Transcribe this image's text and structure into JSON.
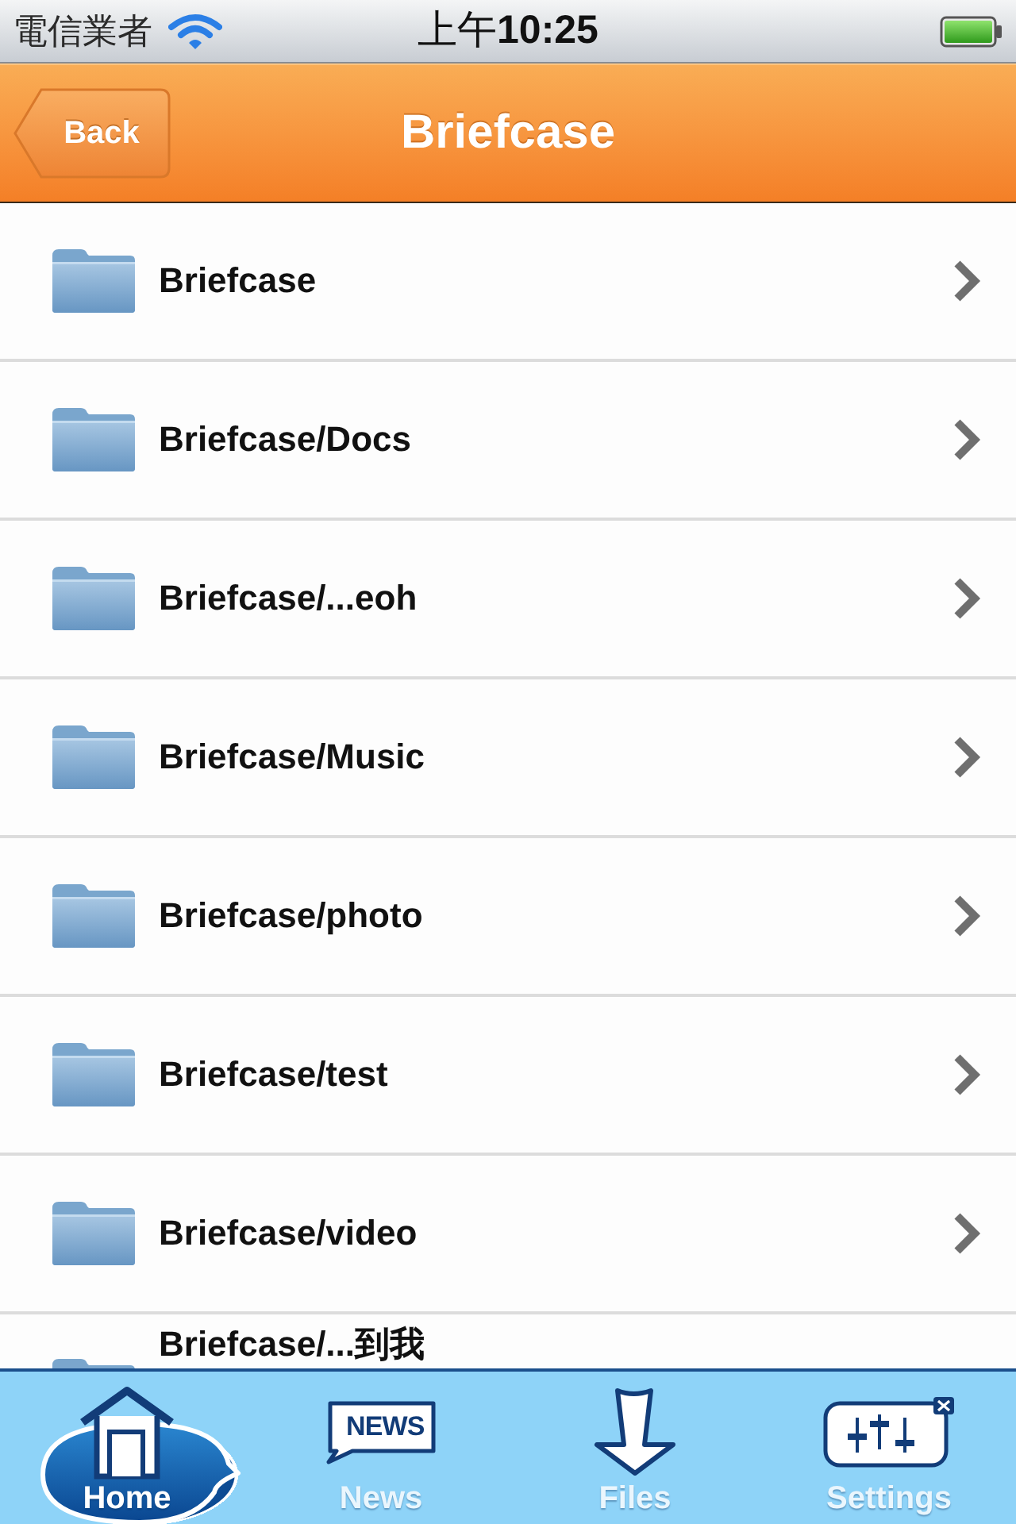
{
  "status_bar": {
    "carrier": "電信業者",
    "time": "上午**10:25**"
  },
  "nav_bar": {
    "back_button": "Back",
    "title": "Briefcase"
  },
  "folders": [
    {
      "name": "Briefcase"
    },
    {
      "name": "Briefcase/Docs"
    },
    {
      "name": "Briefcase/...eoh"
    },
    {
      "name": "Briefcase/Music"
    },
    {
      "name": "Briefcase/photo"
    },
    {
      "name": "Briefcase/test"
    },
    {
      "name": "Briefcase/video"
    },
    {
      "name": "Briefcase/...到我"
    }
  ],
  "tab_bar": [
    {
      "label": "Home",
      "selected": true
    },
    {
      "label": "News",
      "selected": false,
      "icon_text": "NEWS"
    },
    {
      "label": "Files",
      "selected": false
    },
    {
      "label": "Settings",
      "selected": false
    }
  ]
}
